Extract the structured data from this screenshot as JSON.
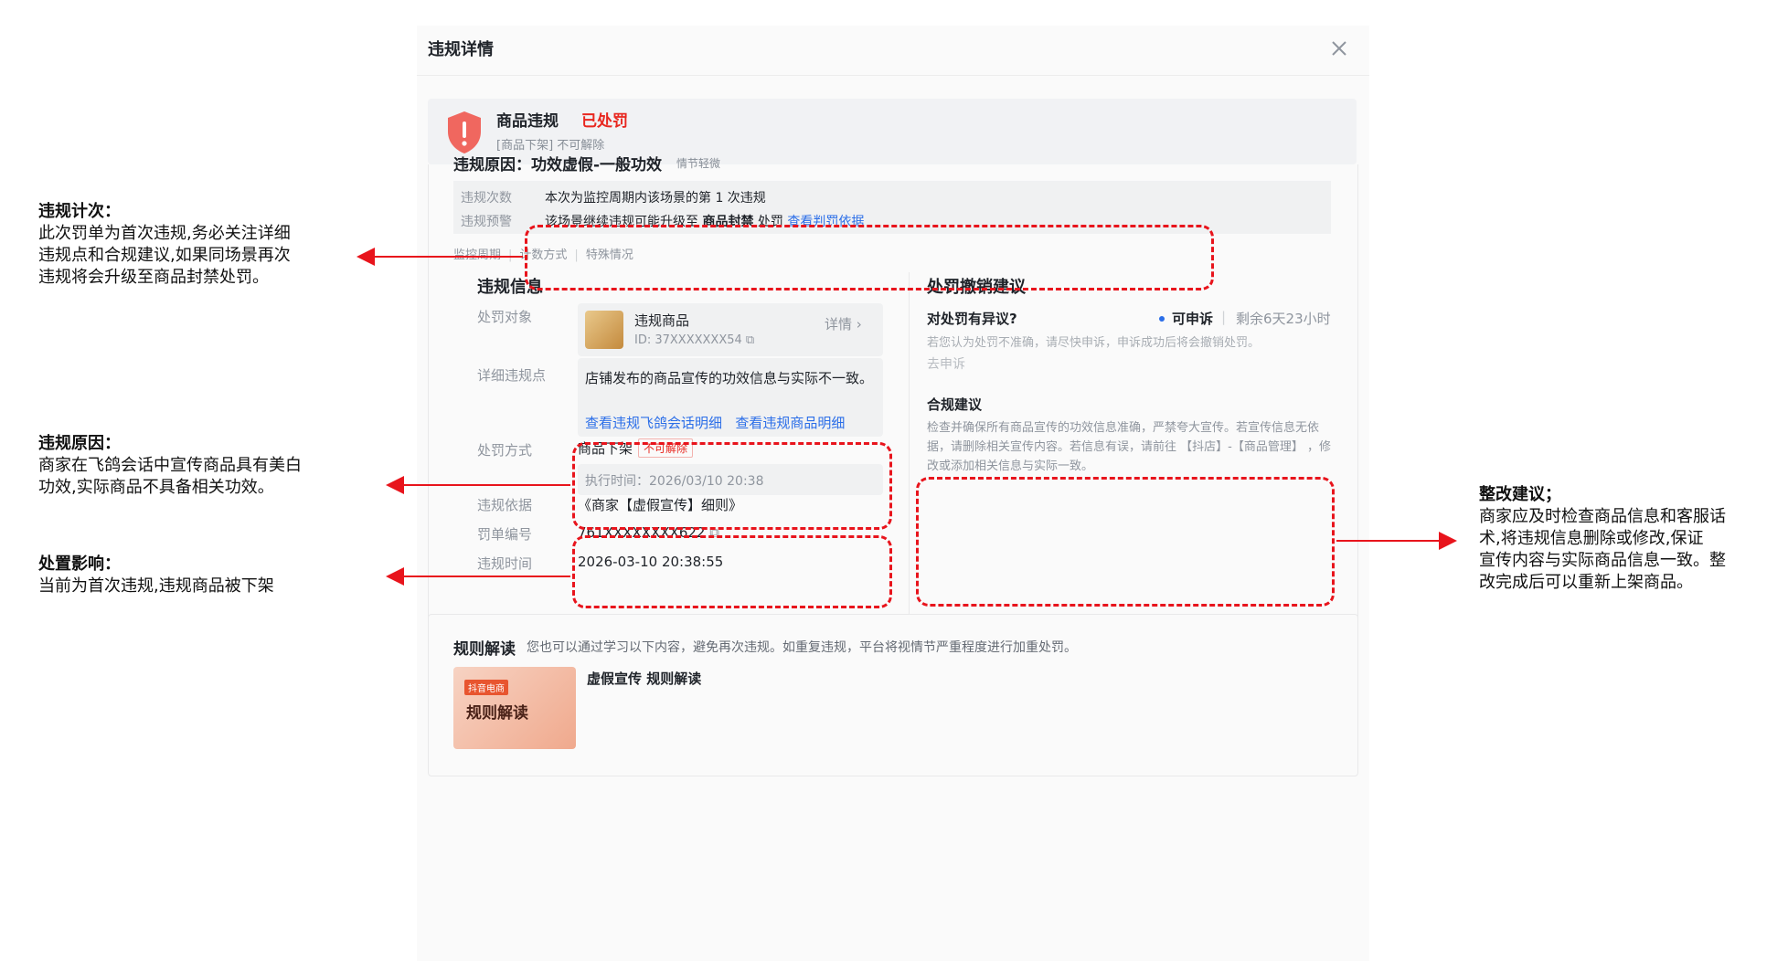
{
  "dialog": {
    "title": "违规详情",
    "status": {
      "type": "商品违规",
      "state": "已处罚",
      "sub": "[商品下架] 不可解除"
    },
    "reason": {
      "label": "违规原因：功效虚假-一般功效",
      "severity": "情节轻微"
    },
    "count": {
      "times_label": "违规次数",
      "times_value": "本次为监控周期内该场景的第 1 次违规",
      "warning_label": "违规预警",
      "warning_prefix": "该场景继续违规可能升级至",
      "warning_bold": "商品封禁",
      "warning_suffix": "处罚",
      "warning_link": "查看判罚依据"
    },
    "subnav": [
      "监控周期",
      "计数方式",
      "特殊情况"
    ],
    "info": {
      "title": "违规信息",
      "target_label": "处罚对象",
      "product_name": "违规商品",
      "product_id": "ID: 37XXXXXXX54",
      "detail_link": "详情 ›",
      "detail_label": "详细违规点",
      "detail_text": "店铺发布的商品宣传的功效信息与实际不一致。",
      "detail_link1": "查看违规飞鸽会话明细",
      "detail_link2": "查看违规商品明细",
      "method_label": "处罚方式",
      "method_value": "商品下架",
      "method_tag": "不可解除",
      "exec_time": "执行时间：2026/03/10 20:38",
      "basis_label": "违规依据",
      "basis_value": "《商家【虚假宣传】细则》",
      "ticket_label": "罚单编号",
      "ticket_value": "761XXXXXXXX622",
      "time_label": "违规时间",
      "time_value": "2026-03-10 20:38:55"
    },
    "revoke": {
      "title": "处罚撤销建议",
      "question": "对处罚有异议?",
      "status": "可申诉",
      "remaining": "剩余6天23小时",
      "hint": "若您认为处罚不准确，请尽快申诉，申诉成功后将会撤销处罚。",
      "appeal_button": "去申诉",
      "compliance_title": "合规建议",
      "compliance_text": "检查并确保所有商品宣传的功效信息准确，严禁夸大宣传。若宣传信息无依据，请删除相关宣传内容。若信息有误，请前往 【抖店】-【商品管理】 ，修改或添加相关信息与实际一致。"
    },
    "rules": {
      "title": "规则解读",
      "desc": "您也可以通过学习以下内容，避免再次违规。如重复违规，平台将视情节严重程度进行加重处罚。",
      "thumb_badge": "抖音电商",
      "thumb_text": "规则解读",
      "item_title": "虚假宣传 规则解读"
    }
  },
  "annotations": {
    "count": {
      "title": "违规计次：",
      "lines": [
        "此次罚单为首次违规,务必关注详细",
        "违规点和合规建议,如果同场景再次",
        "违规将会升级至商品封禁处罚。"
      ]
    },
    "reason": {
      "title": "违规原因：",
      "lines": [
        "商家在飞鸽会话中宣传商品具有美白",
        "功效,实际商品不具备相关功效。"
      ]
    },
    "impact": {
      "title": "处置影响：",
      "lines": [
        "当前为首次违规,违规商品被下架"
      ]
    },
    "fix": {
      "title": "整改建议；",
      "lines": [
        "商家应及时检查商品信息和客服话",
        "术,将违规信息删除或修改,保证",
        "宣传内容与实际商品信息一致。整",
        "改完成后可以重新上架商品。"
      ]
    }
  },
  "colors": {
    "accent": "#2b6ee8",
    "danger": "#e8271f",
    "annotation_red": "#e8141c"
  }
}
